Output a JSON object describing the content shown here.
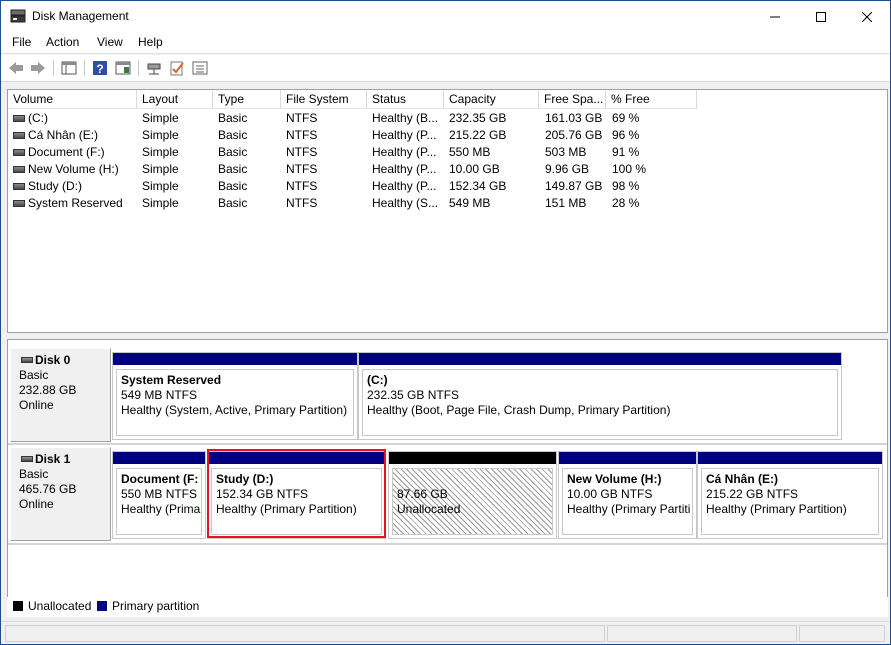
{
  "window": {
    "title": "Disk Management"
  },
  "menu": [
    "File",
    "Action",
    "View",
    "Help"
  ],
  "toolbar_icons": [
    "back-arrow-icon",
    "forward-arrow-icon",
    "console-tree-icon",
    "help-icon",
    "properties-icon",
    "connect-icon",
    "check-icon",
    "list-icon"
  ],
  "columns": [
    "Volume",
    "Layout",
    "Type",
    "File System",
    "Status",
    "Capacity",
    "Free Spa...",
    "% Free"
  ],
  "volumes": [
    {
      "volume": "(C:)",
      "layout": "Simple",
      "type": "Basic",
      "fs": "NTFS",
      "status": "Healthy (B...",
      "capacity": "232.35 GB",
      "free": "161.03 GB",
      "pct": "69 %"
    },
    {
      "volume": "Cá Nhân (E:)",
      "layout": "Simple",
      "type": "Basic",
      "fs": "NTFS",
      "status": "Healthy (P...",
      "capacity": "215.22 GB",
      "free": "205.76 GB",
      "pct": "96 %"
    },
    {
      "volume": "Document (F:)",
      "layout": "Simple",
      "type": "Basic",
      "fs": "NTFS",
      "status": "Healthy (P...",
      "capacity": "550 MB",
      "free": "503 MB",
      "pct": "91 %"
    },
    {
      "volume": "New Volume (H:)",
      "layout": "Simple",
      "type": "Basic",
      "fs": "NTFS",
      "status": "Healthy (P...",
      "capacity": "10.00 GB",
      "free": "9.96 GB",
      "pct": "100 %"
    },
    {
      "volume": "Study (D:)",
      "layout": "Simple",
      "type": "Basic",
      "fs": "NTFS",
      "status": "Healthy (P...",
      "capacity": "152.34 GB",
      "free": "149.87 GB",
      "pct": "98 %"
    },
    {
      "volume": "System Reserved",
      "layout": "Simple",
      "type": "Basic",
      "fs": "NTFS",
      "status": "Healthy (S...",
      "capacity": "549 MB",
      "free": "151 MB",
      "pct": "28 %"
    }
  ],
  "disks": [
    {
      "name": "Disk 0",
      "kind": "Basic",
      "size": "232.88 GB",
      "state": "Online",
      "partitions": [
        {
          "name": "System Reserved",
          "size": "549 MB NTFS",
          "status": "Healthy (System, Active, Primary Partition)"
        },
        {
          "name": "(C:)",
          "size": "232.35 GB NTFS",
          "status": "Healthy (Boot, Page File, Crash Dump, Primary Partition)"
        }
      ]
    },
    {
      "name": "Disk 1",
      "kind": "Basic",
      "size": "465.76 GB",
      "state": "Online",
      "partitions": [
        {
          "name": "Document  (F:",
          "size": "550 MB NTFS",
          "status": "Healthy (Prima"
        },
        {
          "name": "Study  (D:)",
          "size": "152.34 GB NTFS",
          "status": "Healthy (Primary Partition)"
        },
        {
          "name": "",
          "size": "87.66 GB",
          "status": "Unallocated"
        },
        {
          "name": "New Volume  (H:)",
          "size": "10.00 GB NTFS",
          "status": "Healthy (Primary Partiti"
        },
        {
          "name": "Cá Nhân  (E:)",
          "size": "215.22 GB NTFS",
          "status": "Healthy (Primary Partition)"
        }
      ]
    }
  ],
  "legend": {
    "unallocated": "Unallocated",
    "primary": "Primary partition"
  },
  "colors": {
    "primary": "#00007f",
    "unallocated": "#000000",
    "selection": "#e81123"
  }
}
